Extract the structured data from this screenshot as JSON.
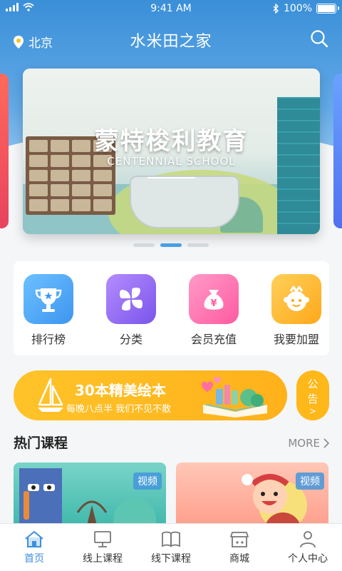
{
  "status": {
    "time": "9:41 AM",
    "battery": "100%",
    "battery_level": 1.0
  },
  "header": {
    "location": "北京",
    "title": "水米田之家"
  },
  "banner": {
    "headline": "蒙特梭利教育",
    "subtitle": "CENTENNIAL SCHOOL",
    "pages": 3,
    "active_page": 1
  },
  "menu": [
    {
      "label": "排行榜",
      "icon": "trophy-icon",
      "color": "#4aa6f0"
    },
    {
      "label": "分类",
      "icon": "category-icon",
      "color": "#9c6cf0"
    },
    {
      "label": "会员充值",
      "icon": "money-bag-icon",
      "color": "#ff6fb0"
    },
    {
      "label": "我要加盟",
      "icon": "join-icon",
      "color": "#ffb21e"
    }
  ],
  "promo": {
    "title": "30本精美绘本",
    "subtitle": "每晚八点半 我们不见不散"
  },
  "notice": {
    "line1": "公",
    "line2": "告",
    "arrow": ">"
  },
  "section": {
    "title": "热门课程",
    "more": "MORE"
  },
  "courses": [
    {
      "badge": "视频"
    },
    {
      "badge": "视频"
    }
  ],
  "tabs": [
    {
      "label": "首页",
      "icon": "home-icon",
      "active": true
    },
    {
      "label": "线上课程",
      "icon": "monitor-icon",
      "active": false
    },
    {
      "label": "线下课程",
      "icon": "book-icon",
      "active": false
    },
    {
      "label": "商城",
      "icon": "shop-icon",
      "active": false
    },
    {
      "label": "个人中心",
      "icon": "user-icon",
      "active": false
    }
  ]
}
